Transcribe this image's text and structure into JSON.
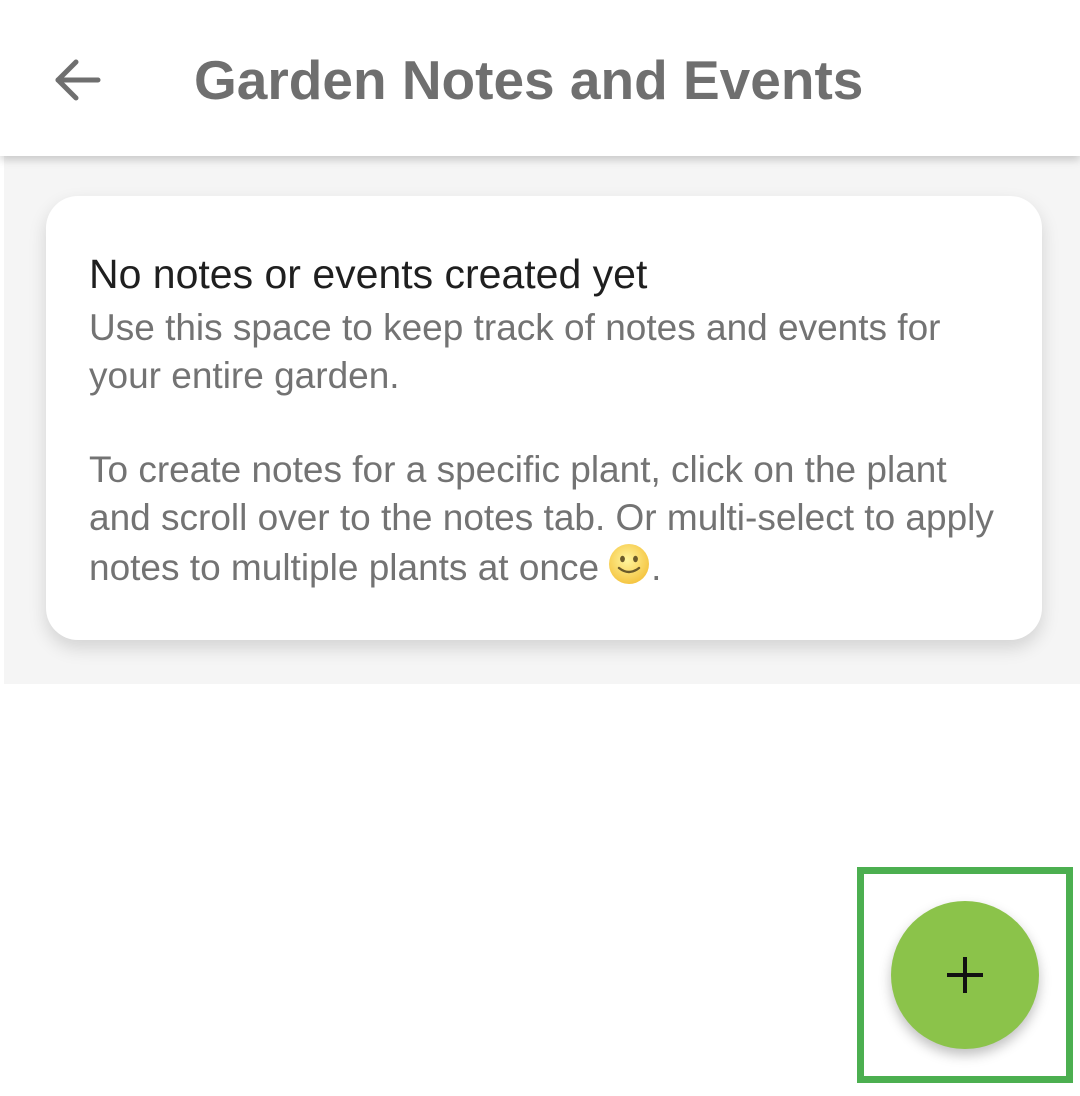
{
  "app_bar": {
    "back_icon": "arrow-left-icon",
    "title": "Garden Notes and Events"
  },
  "empty_state": {
    "title": "No notes or events created yet",
    "body_1": "Use this space to keep track of notes and events for your entire garden.",
    "body_2": "To create notes for a specific plant, click on the plant and scroll over to the notes tab. Or multi-select to apply notes to multiple plants at once",
    "body_2_end": ".",
    "emoji_icon": "slightly-smiling-face-icon"
  },
  "fab": {
    "icon": "plus-icon",
    "color": "#8bc34a",
    "highlight_color": "#4caf50"
  },
  "colors": {
    "title_text": "#6f6f6f",
    "card_title_text": "#1f1f1f",
    "card_body_text": "#737373",
    "content_bg": "#f5f5f5"
  }
}
